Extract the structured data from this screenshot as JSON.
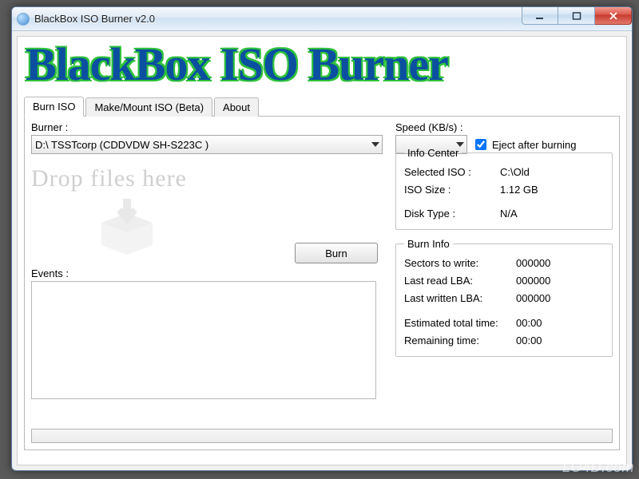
{
  "window": {
    "title": "BlackBox ISO Burner v2.0"
  },
  "banner": "BlackBox ISO Burner",
  "tabs": {
    "burn": "Burn ISO",
    "make": "Make/Mount ISO (Beta)",
    "about": "About"
  },
  "burner": {
    "label": "Burner :",
    "selected": "D:\\  TSSTcorp (CDDVDW SH-S223C )"
  },
  "speed": {
    "label": "Speed (KB/s) :",
    "selected": ""
  },
  "eject": {
    "label": "Eject after burning",
    "checked": true
  },
  "dropzone": {
    "text": "Drop files here"
  },
  "burn_button": "Burn",
  "events": {
    "label": "Events :",
    "text": ""
  },
  "info_center": {
    "legend": "Info Center",
    "selected_iso_label": "Selected ISO :",
    "selected_iso_value": "C:\\Old",
    "iso_size_label": "ISO Size :",
    "iso_size_value": "1.12 GB",
    "disk_type_label": "Disk Type :",
    "disk_type_value": "N/A"
  },
  "burn_info": {
    "legend": "Burn Info",
    "sectors_label": "Sectors to write:",
    "sectors_value": "000000",
    "last_read_label": "Last read LBA:",
    "last_read_value": "000000",
    "last_written_label": "Last written LBA:",
    "last_written_value": "000000",
    "est_time_label": "Estimated total time:",
    "est_time_value": "00:00",
    "remaining_label": "Remaining time:",
    "remaining_value": "00:00"
  },
  "watermark": "LO4D.com"
}
